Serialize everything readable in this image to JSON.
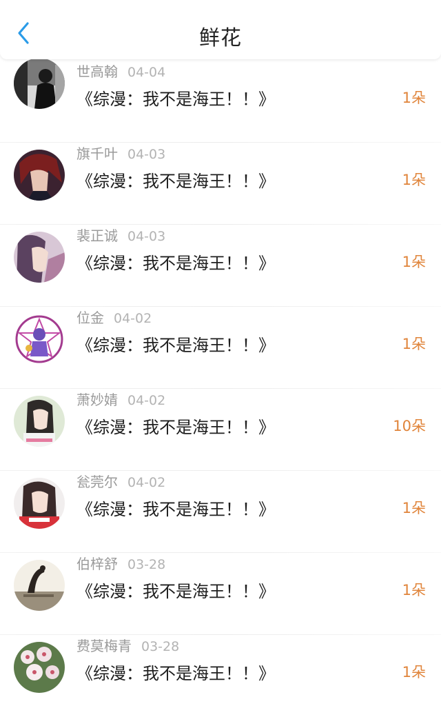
{
  "header": {
    "title": "鲜花",
    "back_icon": "chevron-left-icon",
    "back_color": "#2a9be8"
  },
  "accent_color": "#e0843a",
  "items": [
    {
      "user": "世高翰",
      "date": "04-04",
      "book": "《综漫：我不是海王！！》",
      "count": "1朵",
      "avatar": "avatar-photo-1"
    },
    {
      "user": "旗千叶",
      "date": "04-03",
      "book": "《综漫：我不是海王！！》",
      "count": "1朵",
      "avatar": "avatar-photo-2"
    },
    {
      "user": "裴正诚",
      "date": "04-03",
      "book": "《综漫：我不是海王！！》",
      "count": "1朵",
      "avatar": "avatar-photo-3"
    },
    {
      "user": "位金",
      "date": "04-02",
      "book": "《综漫：我不是海王！！》",
      "count": "1朵",
      "avatar": "avatar-photo-4"
    },
    {
      "user": "萧妙婧",
      "date": "04-02",
      "book": "《综漫：我不是海王！！》",
      "count": "10朵",
      "avatar": "avatar-photo-5"
    },
    {
      "user": "瓮莞尔",
      "date": "04-02",
      "book": "《综漫：我不是海王！！》",
      "count": "1朵",
      "avatar": "avatar-photo-6"
    },
    {
      "user": "伯梓舒",
      "date": "03-28",
      "book": "《综漫：我不是海王！！》",
      "count": "1朵",
      "avatar": "avatar-photo-7"
    },
    {
      "user": "费莫梅青",
      "date": "03-28",
      "book": "《综漫：我不是海王！！》",
      "count": "1朵",
      "avatar": "avatar-photo-8"
    }
  ]
}
